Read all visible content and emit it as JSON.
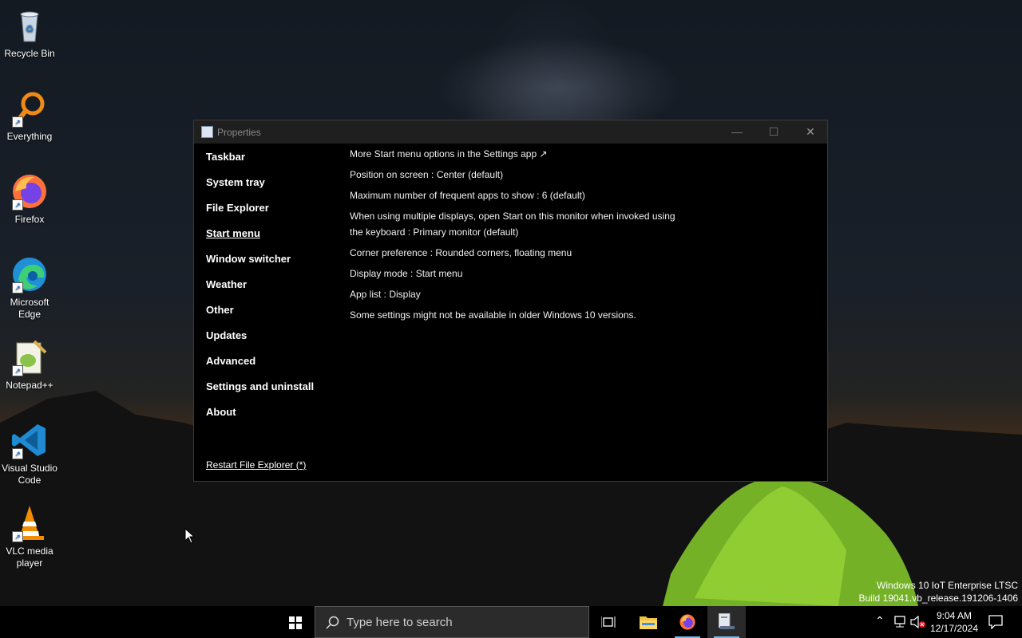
{
  "desktop": {
    "icons": [
      {
        "label": "Recycle Bin"
      },
      {
        "label": "Everything"
      },
      {
        "label": "Firefox"
      },
      {
        "label": "Microsoft Edge"
      },
      {
        "label": "Notepad++"
      },
      {
        "label": "Visual Studio Code"
      },
      {
        "label": "VLC media player"
      }
    ],
    "watermark": {
      "line1": "Windows 10 IoT Enterprise LTSC",
      "line2": "Build 19041.vb_release.191206-1406"
    }
  },
  "window": {
    "title": "Properties",
    "controls": {
      "minimize": "—",
      "maximize": "☐",
      "close": "✕"
    },
    "nav": [
      {
        "label": "Taskbar"
      },
      {
        "label": "System tray"
      },
      {
        "label": "File Explorer"
      },
      {
        "label": "Start menu"
      },
      {
        "label": "Window switcher"
      },
      {
        "label": "Weather"
      },
      {
        "label": "Other"
      },
      {
        "label": "Updates"
      },
      {
        "label": "Advanced"
      },
      {
        "label": "Settings and uninstall"
      },
      {
        "label": "About"
      }
    ],
    "active_nav": "Start menu",
    "restart_link": "Restart File Explorer (*)",
    "settings": [
      {
        "text": "More Start menu options in the Settings app ↗"
      },
      {
        "text": "Position on screen : Center (default)"
      },
      {
        "text": "Maximum number of frequent apps to show : 6 (default)"
      },
      {
        "text": "When using multiple displays, open Start on this monitor when invoked using the keyboard : Primary monitor (default)"
      },
      {
        "text": "Corner preference : Rounded corners, floating menu"
      },
      {
        "text": "Display mode : Start menu"
      },
      {
        "text": "App list : Display"
      },
      {
        "text": "Some settings might not be available in older Windows 10 versions."
      }
    ]
  },
  "taskbar": {
    "search_placeholder": "Type here to search",
    "clock": {
      "time": "9:04 AM",
      "date": "12/17/2024"
    },
    "accent_color": "#76b9ed"
  }
}
